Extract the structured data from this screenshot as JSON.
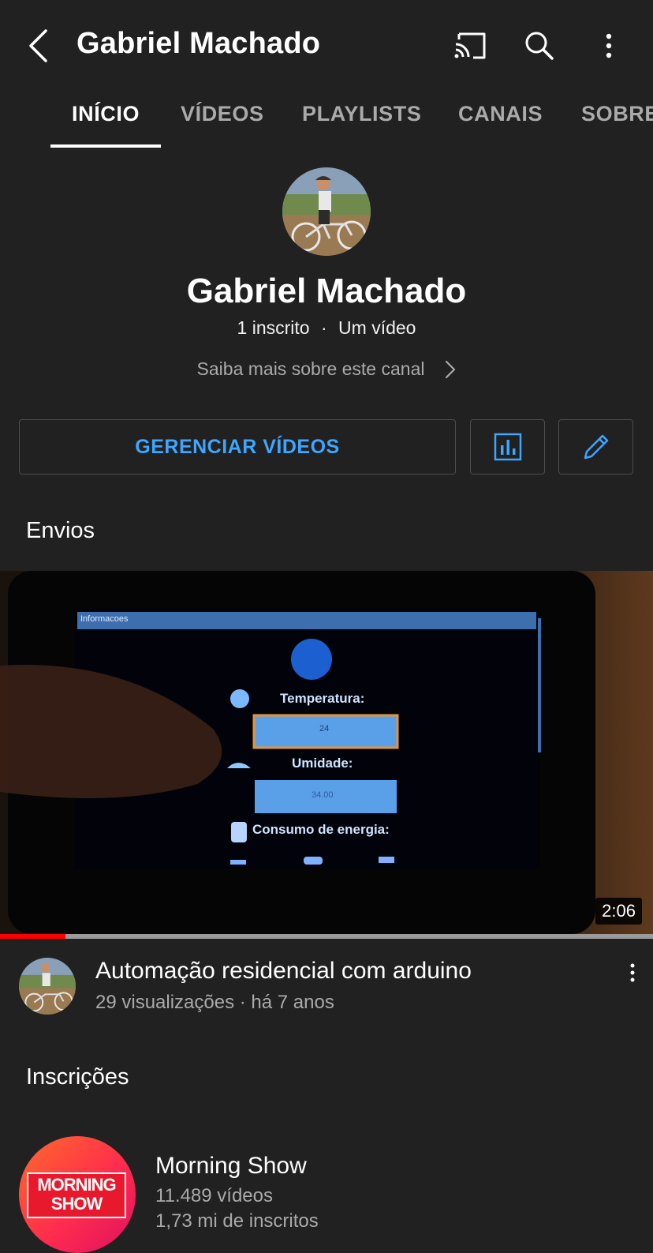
{
  "header": {
    "title": "Gabriel Machado",
    "back_icon": "chevron-left-icon",
    "cast_icon": "cast-icon",
    "search_icon": "search-icon",
    "more_icon": "more-vertical-icon"
  },
  "tabs": [
    {
      "label": "INÍCIO",
      "active": true
    },
    {
      "label": "VÍDEOS",
      "active": false
    },
    {
      "label": "PLAYLISTS",
      "active": false
    },
    {
      "label": "CANAIS",
      "active": false
    },
    {
      "label": "SOBRE",
      "active": false
    }
  ],
  "channel": {
    "name": "Gabriel Machado",
    "subscribers": "1 inscrito",
    "separator": "·",
    "video_count": "Um vídeo",
    "about_link": "Saiba mais sobre este canal"
  },
  "actions": {
    "manage_videos": "GERENCIAR VÍDEOS",
    "analytics_icon": "analytics-icon",
    "edit_icon": "pencil-icon"
  },
  "uploads": {
    "section_title": "Envios",
    "video": {
      "title": "Automação residencial com arduino",
      "meta": "29 visualizações · há 7 anos",
      "duration": "2:06",
      "watched_fraction": 0.1,
      "thumbnail_text": {
        "top_bar": "Informacoes",
        "temperature_label": "Temperatura:",
        "temperature_value": "24",
        "humidity_label": "Umidade:",
        "humidity_value": "34.00",
        "energy_label": "Consumo de energia:"
      }
    }
  },
  "subscriptions": {
    "section_title": "Inscrições",
    "items": [
      {
        "name": "Morning Show",
        "videos": "11.489 vídeos",
        "subscribers": "1,73 mi de inscritos",
        "logo_line1": "MORNING",
        "logo_line2": "SHOW"
      }
    ]
  },
  "colors": {
    "background": "#212121",
    "accent_blue": "#3ea6ff",
    "progress_red": "#ff0000",
    "secondary_text": "#aaaaaa"
  }
}
